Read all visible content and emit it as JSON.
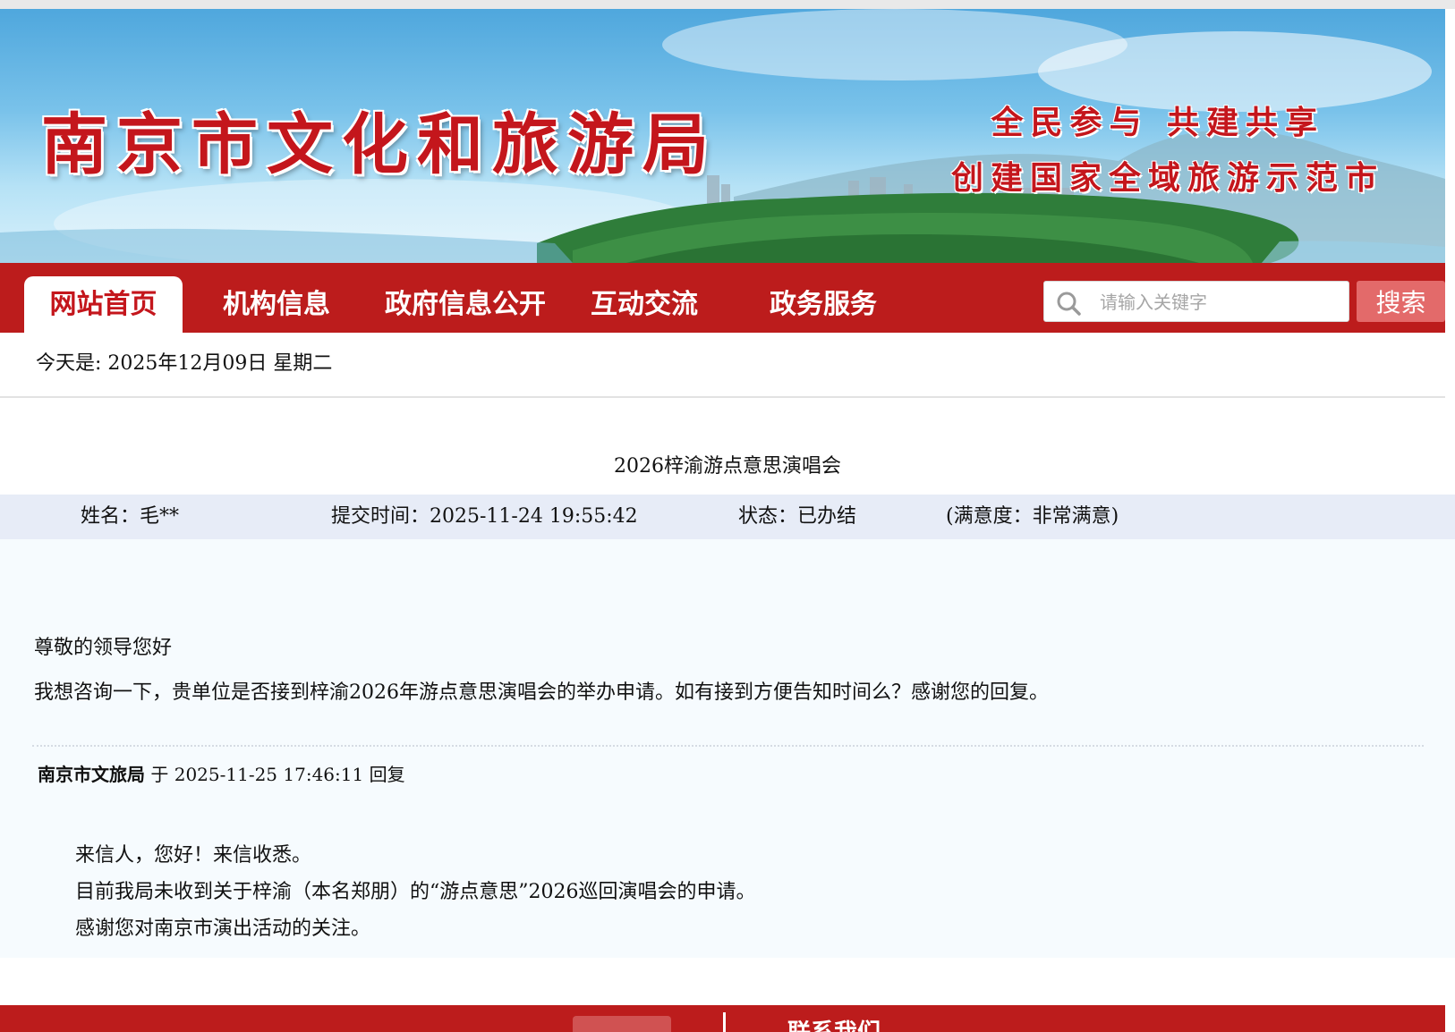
{
  "header": {
    "site_title": "南京市文化和旅游局",
    "slogan_line1": "全民参与 共建共享",
    "slogan_line2": "创建国家全域旅游示范市"
  },
  "nav": {
    "items": [
      {
        "label": "网站首页",
        "active": true
      },
      {
        "label": "机构信息",
        "active": false
      },
      {
        "label": "政府信息公开",
        "active": false
      },
      {
        "label": "互动交流",
        "active": false
      },
      {
        "label": "政务服务",
        "active": false
      }
    ]
  },
  "search": {
    "placeholder": "请输入关键字",
    "button_label": "搜索"
  },
  "date_line": "今天是: 2025年12月09日 星期二",
  "article": {
    "title": "2026梓渝游点意思演唱会",
    "meta": {
      "name": "姓名：毛**",
      "submit_time": "提交时间：2025-11-24 19:55:42",
      "status": "状态：已办结",
      "satisfaction": "(满意度：非常满意)"
    },
    "letter": [
      "尊敬的领导您好",
      "我想咨询一下，贵单位是否接到梓渝2026年游点意思演唱会的举办申请。如有接到方便告知时间么？感谢您的回复。"
    ],
    "reply": {
      "org": "南京市文旅局",
      "time_text": " 于 2025-11-25 17:46:11 回复",
      "paragraphs": [
        "来信人，您好！来信收悉。",
        "目前我局未收到关于梓渝（本名郑朋）的“游点意思”2026巡回演唱会的申请。",
        "感谢您对南京市演出活动的关注。"
      ]
    }
  },
  "footer": {
    "contact_label": "联系我们"
  },
  "colors": {
    "brand_red": "#bc1c1c",
    "title_red": "#c4161c",
    "meta_bar": "#e7ecf7",
    "search_button": "#e36a6a"
  }
}
